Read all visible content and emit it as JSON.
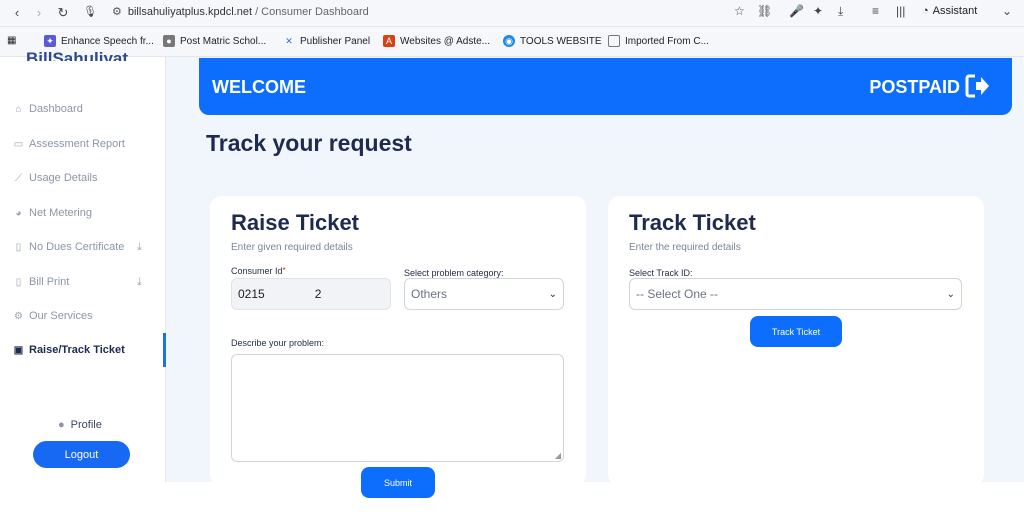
{
  "browser": {
    "url_host": "billsahuliyatplus.kpdcl.net",
    "url_path": " / Consumer Dashboard",
    "assistant_label": "Assistant",
    "bookmarks": [
      {
        "label": "Enhance Speech fr...",
        "color": "#5b5bd6"
      },
      {
        "label": "Post Matric Schol...",
        "color": "#555555"
      },
      {
        "label": "Publisher Panel",
        "color": "#2a6fdb"
      },
      {
        "label": "Websites @ Adste...",
        "color": "#d84315"
      },
      {
        "label": "TOOLS WEBSITE",
        "color": "#1e88e5"
      },
      {
        "label": "Imported From C...",
        "color": "#666666"
      }
    ]
  },
  "sidebar": {
    "brand": "BillSahuliyat",
    "items": [
      {
        "label": "Dashboard",
        "icon": "home-icon"
      },
      {
        "label": "Assessment Report",
        "icon": "report-icon"
      },
      {
        "label": "Usage Details",
        "icon": "chart-icon"
      },
      {
        "label": "Net Metering",
        "icon": "meter-icon"
      },
      {
        "label": "No Dues Certificate",
        "icon": "certificate-icon"
      },
      {
        "label": "Bill Print",
        "icon": "bill-icon"
      },
      {
        "label": "Our Services",
        "icon": "services-icon"
      },
      {
        "label": "Raise/Track Ticket",
        "icon": "ticket-icon"
      }
    ],
    "profile_label": "Profile",
    "logout_label": "Logout"
  },
  "banner": {
    "welcome": "WELCOME",
    "plan": "POSTPAID"
  },
  "page_title": "Track your request",
  "raise": {
    "title": "Raise Ticket",
    "subtitle": "Enter given required details",
    "consumer_label": "Consumer Id",
    "consumer_value": "0215",
    "consumer_tail": "2",
    "category_label": "Select problem category:",
    "category_value": "Others",
    "describe_label": "Describe your problem:",
    "submit_label": "Submit"
  },
  "track": {
    "title": "Track Ticket",
    "subtitle": "Enter the required details",
    "select_label": "Select Track ID:",
    "select_value": "-- Select One --",
    "button_label": "Track Ticket"
  },
  "colors": {
    "accent": "#0d6efd",
    "page_bg": "#f1f5fc",
    "heading": "#1f2a4e"
  }
}
